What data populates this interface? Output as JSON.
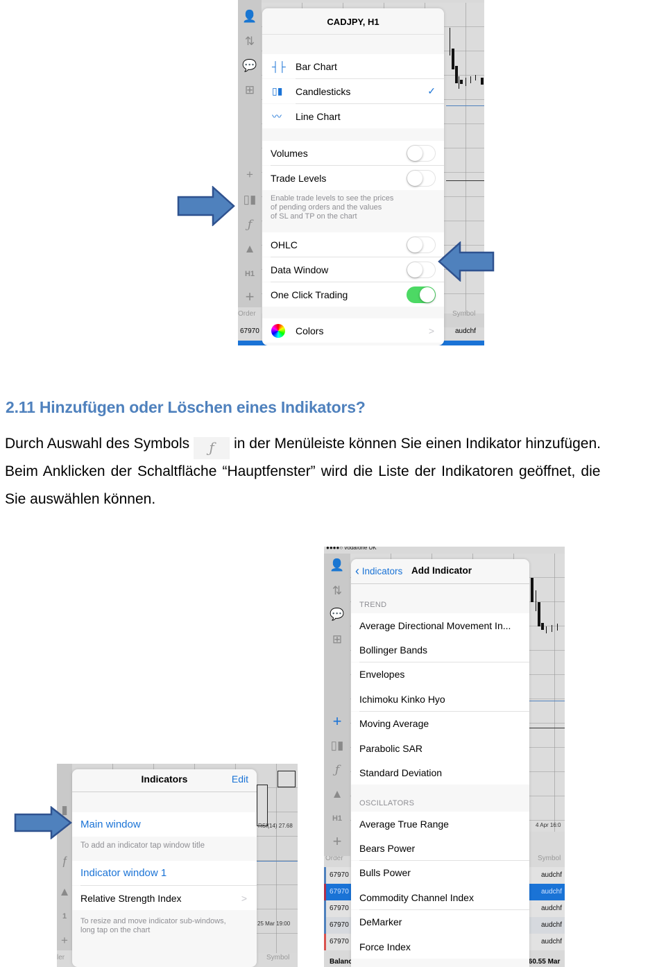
{
  "screenshot_top": {
    "title": "CADJPY, H1",
    "chart_types": [
      {
        "label": "Bar Chart",
        "icon": "bar-chart-icon",
        "selected": false
      },
      {
        "label": "Candlesticks",
        "icon": "candlesticks-icon",
        "selected": true
      },
      {
        "label": "Line Chart",
        "icon": "line-chart-icon",
        "selected": false
      }
    ],
    "toggles": [
      {
        "label": "Volumes",
        "on": false
      },
      {
        "label": "Trade Levels",
        "on": false
      }
    ],
    "trade_levels_hint": [
      "Enable trade levels to see the prices",
      "of pending orders and the values",
      "of SL and TP on the chart"
    ],
    "toggles2": [
      {
        "label": "OHLC",
        "on": false
      },
      {
        "label": "Data Window",
        "on": false
      },
      {
        "label": "One Click Trading",
        "on": true
      }
    ],
    "colors_label": "Colors",
    "checkmark": "✓",
    "chevron": ">",
    "background": {
      "chart_label": "CADJPY, H1",
      "order_header": "Order",
      "symbol_header": "Symbol",
      "order_value": "67970",
      "symbol_value": "audchf",
      "h1_label": "H1"
    }
  },
  "document": {
    "heading": "2.11 Hinzufügen oder Löschen eines Indikators?",
    "para_line1_a": "Durch Auswahl des Symbols",
    "para_line1_b": "in der Menüleiste können Sie einen Indikator hinzufügen.",
    "para_line2": "Beim Anklicken der Schaltfläche “Hauptfenster” wird die Liste der Indikatoren geöffnet, die",
    "para_line3": "Sie auswählen können.",
    "inline_icon": "ƒ"
  },
  "screenshot_left": {
    "title": "Indicators",
    "edit_label": "Edit",
    "main_window": "Main window",
    "main_hint": "To add an indicator tap window title",
    "indicator_window": "Indicator window 1",
    "rsi_label": "Relative Strength Index",
    "resize_hint": [
      "To resize and move indicator sub-windows,",
      "long tap on the chart"
    ],
    "chevron": ">",
    "background": {
      "rsi_readout": "RSI(14) 27.68",
      "date_label": "25 Mar 19:00",
      "symbol_header": "Symbol",
      "order_header": "ler",
      "h1_label": "1"
    }
  },
  "screenshot_right": {
    "status_bar": "●●●●○ vodafone UK",
    "back_label": "Indicators",
    "title": "Add Indicator",
    "trend_header": "TREND",
    "trend_items": [
      "Average Directional Movement In...",
      "Bollinger Bands",
      "Envelopes",
      "Ichimoku Kinko Hyo",
      "Moving Average",
      "Parabolic SAR",
      "Standard Deviation"
    ],
    "oscillators_header": "OSCILLATORS",
    "oscillator_items": [
      "Average True Range",
      "Bears Power",
      "Bulls Power",
      "Commodity Channel Index",
      "DeMarker",
      "Force Index"
    ],
    "background": {
      "date_label": "4 Apr 16:0",
      "order_header": "Order",
      "symbol_header": "Symbol",
      "orders": [
        "67970",
        "67970",
        "67970",
        "67970",
        "67970"
      ],
      "symbols": [
        "audchf",
        "audchf",
        "audchf",
        "audchf",
        "audchf"
      ],
      "selected_row": 1,
      "balance_label": "Balanc",
      "balance_value": ".60.55 Mar",
      "h1_label": "H1"
    }
  },
  "colors": {
    "accent_blue": "#1a73d6",
    "heading_blue": "#4f81bd",
    "arrow_fill": "#4f81bd",
    "arrow_stroke": "#2f528f",
    "toggle_on": "#4cd964"
  }
}
